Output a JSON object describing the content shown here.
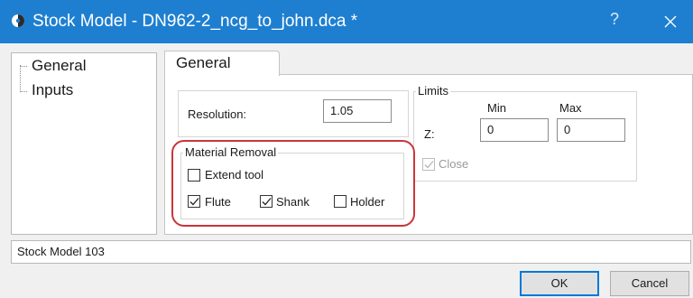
{
  "window": {
    "title": "Stock Model - DN962-2_ncg_to_john.dca *",
    "help_label": "?",
    "icon": "app-icon"
  },
  "tree": {
    "items": [
      {
        "label": "General"
      },
      {
        "label": "Inputs"
      }
    ]
  },
  "tabs": [
    {
      "label": "General",
      "active": true
    }
  ],
  "general": {
    "resolution_label": "Resolution:",
    "resolution_value": "1.05",
    "material_removal": {
      "title": "Material Removal",
      "extend_tool": {
        "label": "Extend tool",
        "checked": false
      },
      "flute": {
        "label": "Flute",
        "checked": true
      },
      "shank": {
        "label": "Shank",
        "checked": true
      },
      "holder": {
        "label": "Holder",
        "checked": false
      }
    },
    "limits": {
      "title": "Limits",
      "min_label": "Min",
      "max_label": "Max",
      "z_label": "Z:",
      "z_min": "0",
      "z_max": "0",
      "close": {
        "label": "Close",
        "checked": true,
        "enabled": false
      }
    }
  },
  "status_text": "Stock Model 103",
  "buttons": {
    "ok": "OK",
    "cancel": "Cancel"
  },
  "colors": {
    "titlebar": "#1e7fd0",
    "highlight_annotation": "#c9353a",
    "default_button_border": "#0078d7"
  }
}
